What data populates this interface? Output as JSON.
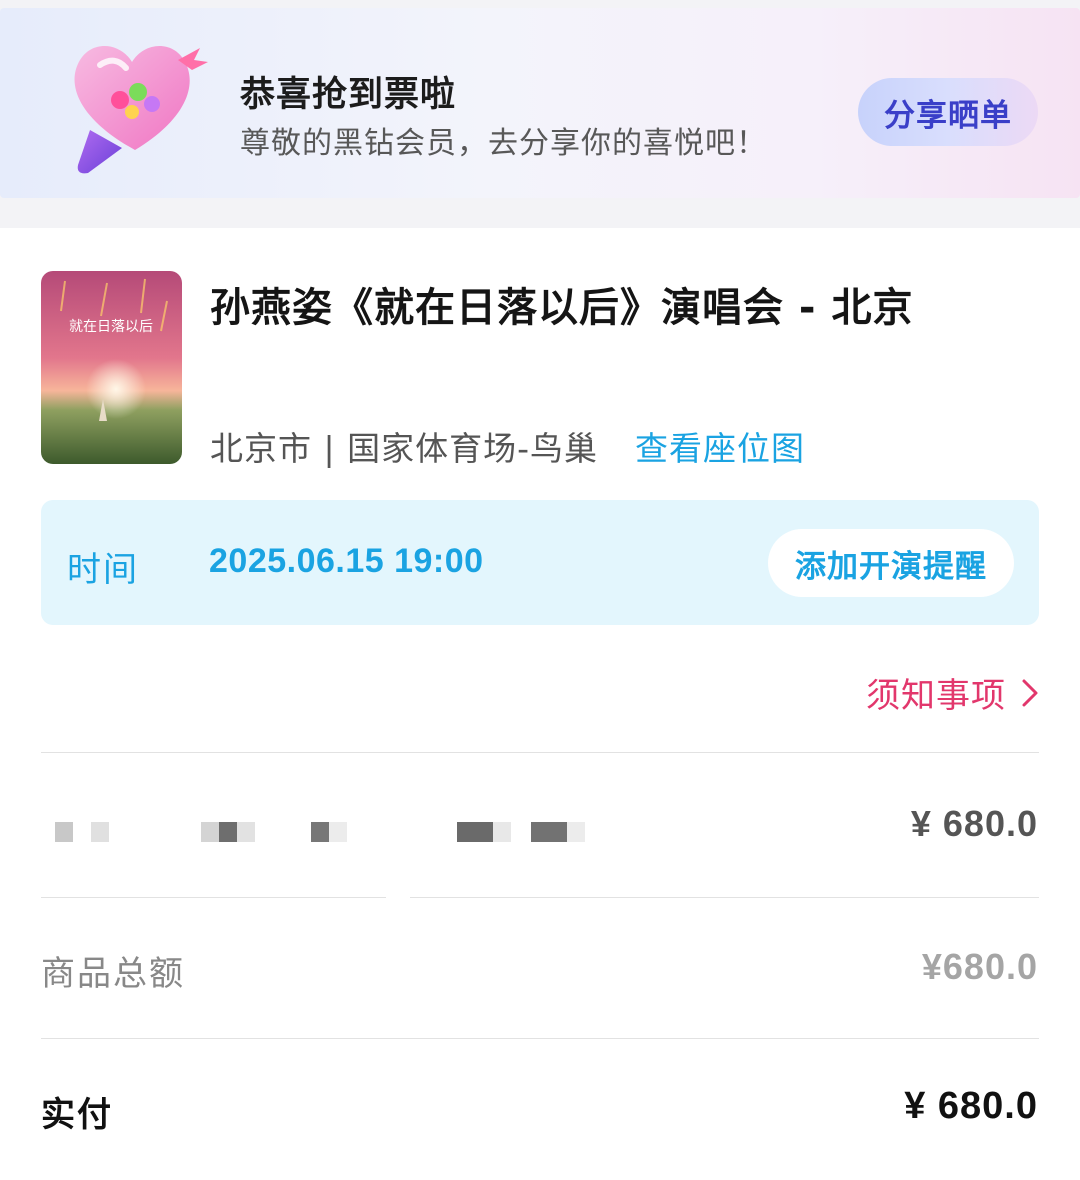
{
  "banner": {
    "title": "恭喜抢到票啦",
    "subtitle": "尊敬的黑钻会员，去分享你的喜悦吧！",
    "share_button": "分享晒单",
    "mascot_icon": "heart-lightstick-icon"
  },
  "event": {
    "title": "孙燕姿《就在日落以后》演唱会 - 北京",
    "venue": "北京市 | 国家体育场-鸟巢",
    "seat_map_link": "查看座位图",
    "poster_text": "就在日落以后"
  },
  "schedule": {
    "label": "时间",
    "datetime": "2025.06.15 19:00",
    "remind_button": "添加开演提醒"
  },
  "notice": {
    "label": "须知事项",
    "icon": "chevron-right-icon"
  },
  "ticket": {
    "price": "¥ 680.0"
  },
  "summary": {
    "total_label": "商品总额",
    "total_value": "¥680.0",
    "paid_label": "实付",
    "paid_value": "¥ 680.0"
  },
  "colors": {
    "accent_blue": "#1aa3e2",
    "accent_pink": "#e2376c",
    "share_text": "#3a3fc8"
  }
}
